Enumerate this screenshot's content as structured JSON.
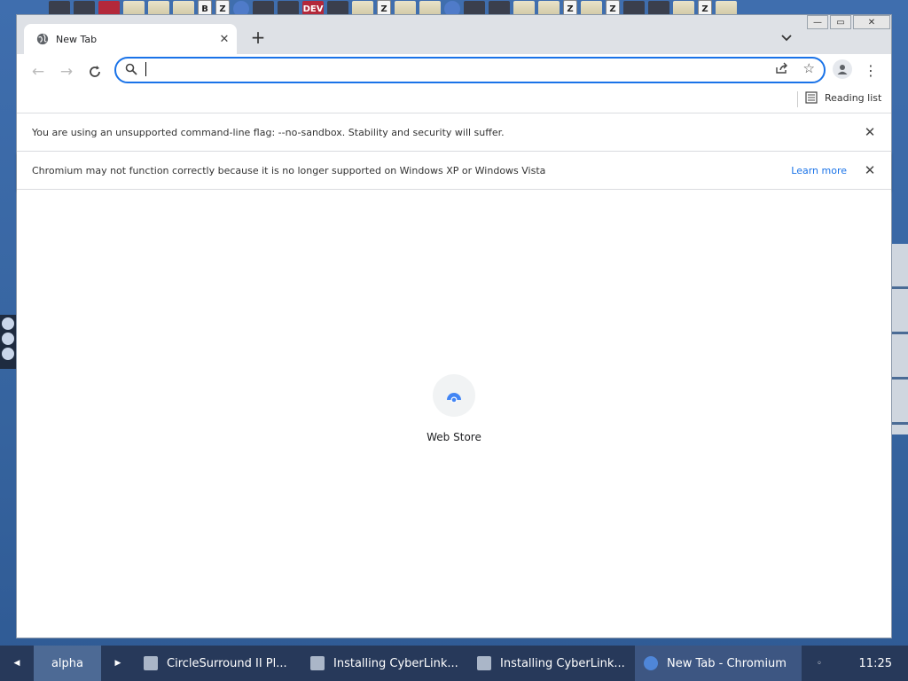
{
  "browser": {
    "tab": {
      "title": "New Tab"
    },
    "toolbar": {
      "omnibox_value": ""
    },
    "bookmarks_bar": {
      "reading_list_label": "Reading list"
    },
    "infobars": [
      {
        "message": "You are using an unsupported command-line flag: --no-sandbox. Stability and security will suffer."
      },
      {
        "message": "Chromium may not function correctly because it is no longer supported on Windows XP or Windows Vista",
        "link": "Learn more"
      }
    ],
    "content": {
      "shortcut_label": "Web Store"
    }
  },
  "desktop_strip_labels": [
    "B",
    "Z",
    "DEV",
    "Z",
    "Z",
    "Z",
    "Z"
  ],
  "taskbar": {
    "workspace": "alpha",
    "tasks": [
      {
        "label": "CircleSurround II Pl..."
      },
      {
        "label": "Installing CyberLink..."
      },
      {
        "label": "Installing CyberLink..."
      },
      {
        "label": "New Tab - Chromium"
      }
    ],
    "clock": "11:25"
  },
  "colors": {
    "accent": "#1a73e8",
    "taskbar": "#27395a",
    "desktop": "#3d6aa8"
  }
}
